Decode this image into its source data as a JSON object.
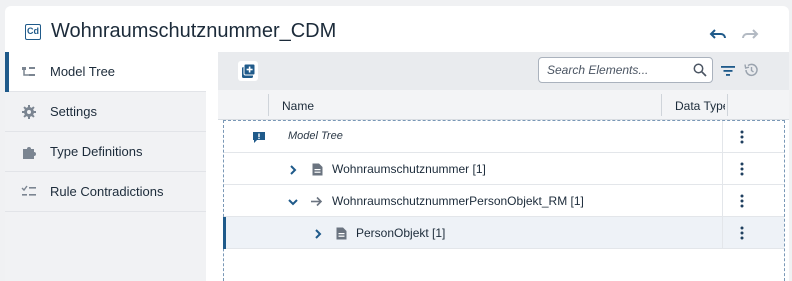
{
  "header": {
    "app_badge": "Cd",
    "title": "Wohnraumschutznummer_CDM",
    "undo_icon": "undo-icon",
    "redo_icon": "redo-icon"
  },
  "sidebar": {
    "items": [
      {
        "label": "Model Tree",
        "icon": "model-tree-icon",
        "active": true
      },
      {
        "label": "Settings",
        "icon": "gear-icon",
        "active": false
      },
      {
        "label": "Type Definitions",
        "icon": "puzzle-icon",
        "active": false
      },
      {
        "label": "Rule Contradictions",
        "icon": "rule-list-icon",
        "active": false
      }
    ]
  },
  "toolbar": {
    "add_icon": "add-element-icon",
    "search_placeholder": "Search Elements...",
    "search_icon": "search-icon",
    "filter_icon": "filter-icon",
    "history_icon": "history-icon"
  },
  "table": {
    "columns": [
      "Name",
      "Data Type"
    ],
    "rows": [
      {
        "label": "Model Tree",
        "icon": "model-tree-badge-icon",
        "italic": true
      },
      {
        "label": "Wohnraumschutznummer [1]",
        "expander": "chevron-right-icon",
        "icon": "document-icon"
      },
      {
        "label": "WohnraumschutznummerPersonObjekt_RM [1]",
        "expander": "chevron-down-icon",
        "icon": "arrow-right-icon"
      },
      {
        "label": "PersonObjekt [1]",
        "expander": "chevron-right-icon",
        "icon": "document-icon",
        "selected": true
      }
    ]
  },
  "colors": {
    "accent": "#1f5a8a",
    "sidebar_bg": "#f1f2f4",
    "toolbar_bg": "#e9ebee"
  }
}
